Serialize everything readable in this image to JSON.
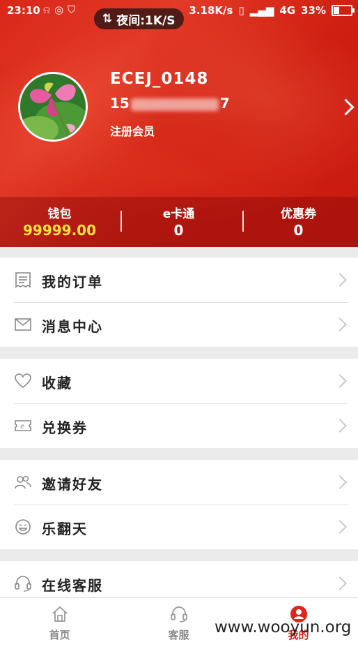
{
  "status_bar": {
    "time": "23:10",
    "speed": "3.18K/s",
    "network": "4G",
    "battery": "33%"
  },
  "night_mode": {
    "label": "夜间:1K/S"
  },
  "profile": {
    "username": "ECEJ_0148",
    "phone_prefix": "15",
    "phone_suffix": "7",
    "member_level": "注册会员"
  },
  "stats": [
    {
      "label": "钱包",
      "value": "99999.00"
    },
    {
      "label": "e卡通",
      "value": "0"
    },
    {
      "label": "优惠券",
      "value": "0"
    }
  ],
  "menu": {
    "orders": "我的订单",
    "messages": "消息中心",
    "favorites": "收藏",
    "exchange": "兑换券",
    "invite": "邀请好友",
    "fun": "乐翻天",
    "service": "在线客服"
  },
  "tabs": [
    {
      "label": "首页",
      "icon": "home-icon"
    },
    {
      "label": "客服",
      "icon": "headset-icon"
    },
    {
      "label": "我的",
      "icon": "user-icon"
    }
  ],
  "watermark": "www.wooyun.org",
  "colors": {
    "brand_red": "#d9271a",
    "wallet_value": "#ffe23a",
    "active_tab": "#e0231b"
  }
}
